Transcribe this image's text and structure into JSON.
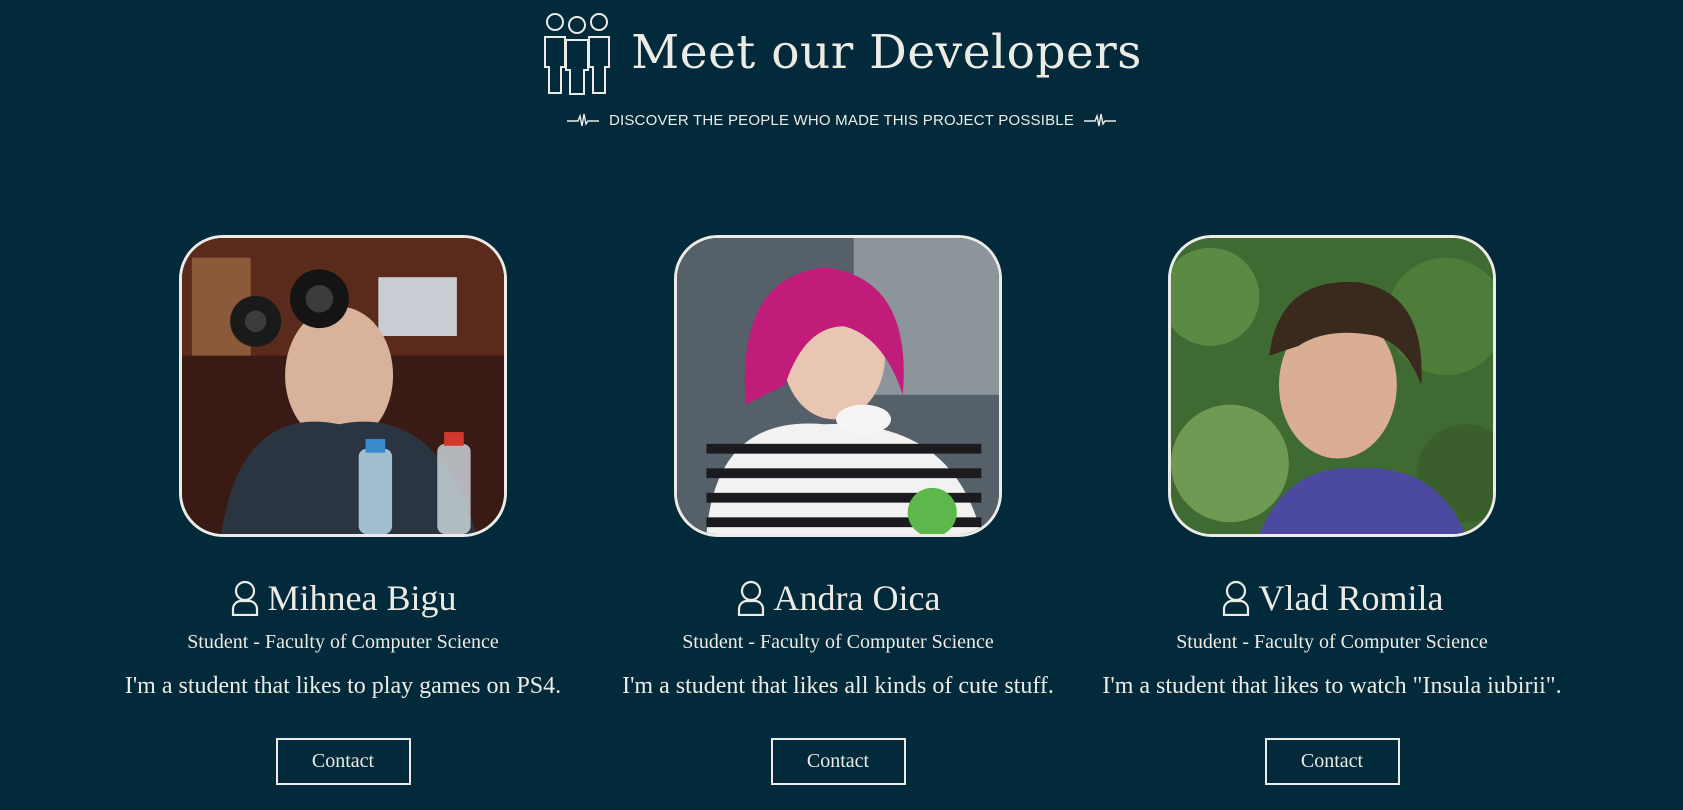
{
  "header": {
    "title": "Meet our Developers",
    "subtitle": "DISCOVER THE PEOPLE WHO MADE THIS PROJECT POSSIBLE",
    "team_icon": "team-icon",
    "pulse_icon": "pulse-line-icon"
  },
  "colors": {
    "background": "#022a3a",
    "text": "#ecebe6"
  },
  "developers": [
    {
      "name": "Mihnea Bigu",
      "role": "Student - Faculty of Computer Science",
      "bio": "I'm a student that likes to play games on PS4.",
      "contact_label": "Contact",
      "icon": "user-icon",
      "photo_alt": "Mihnea Bigu"
    },
    {
      "name": "Andra Oica",
      "role": "Student - Faculty of Computer Science",
      "bio": "I'm a student that likes all kinds of cute stuff.",
      "contact_label": "Contact",
      "icon": "user-icon",
      "photo_alt": "Andra Oica"
    },
    {
      "name": "Vlad Romila",
      "role": "Student - Faculty of Computer Science",
      "bio": "I'm a student that likes to watch \"Insula iubirii\".",
      "contact_label": "Contact",
      "icon": "user-icon",
      "photo_alt": "Vlad Romila"
    }
  ]
}
